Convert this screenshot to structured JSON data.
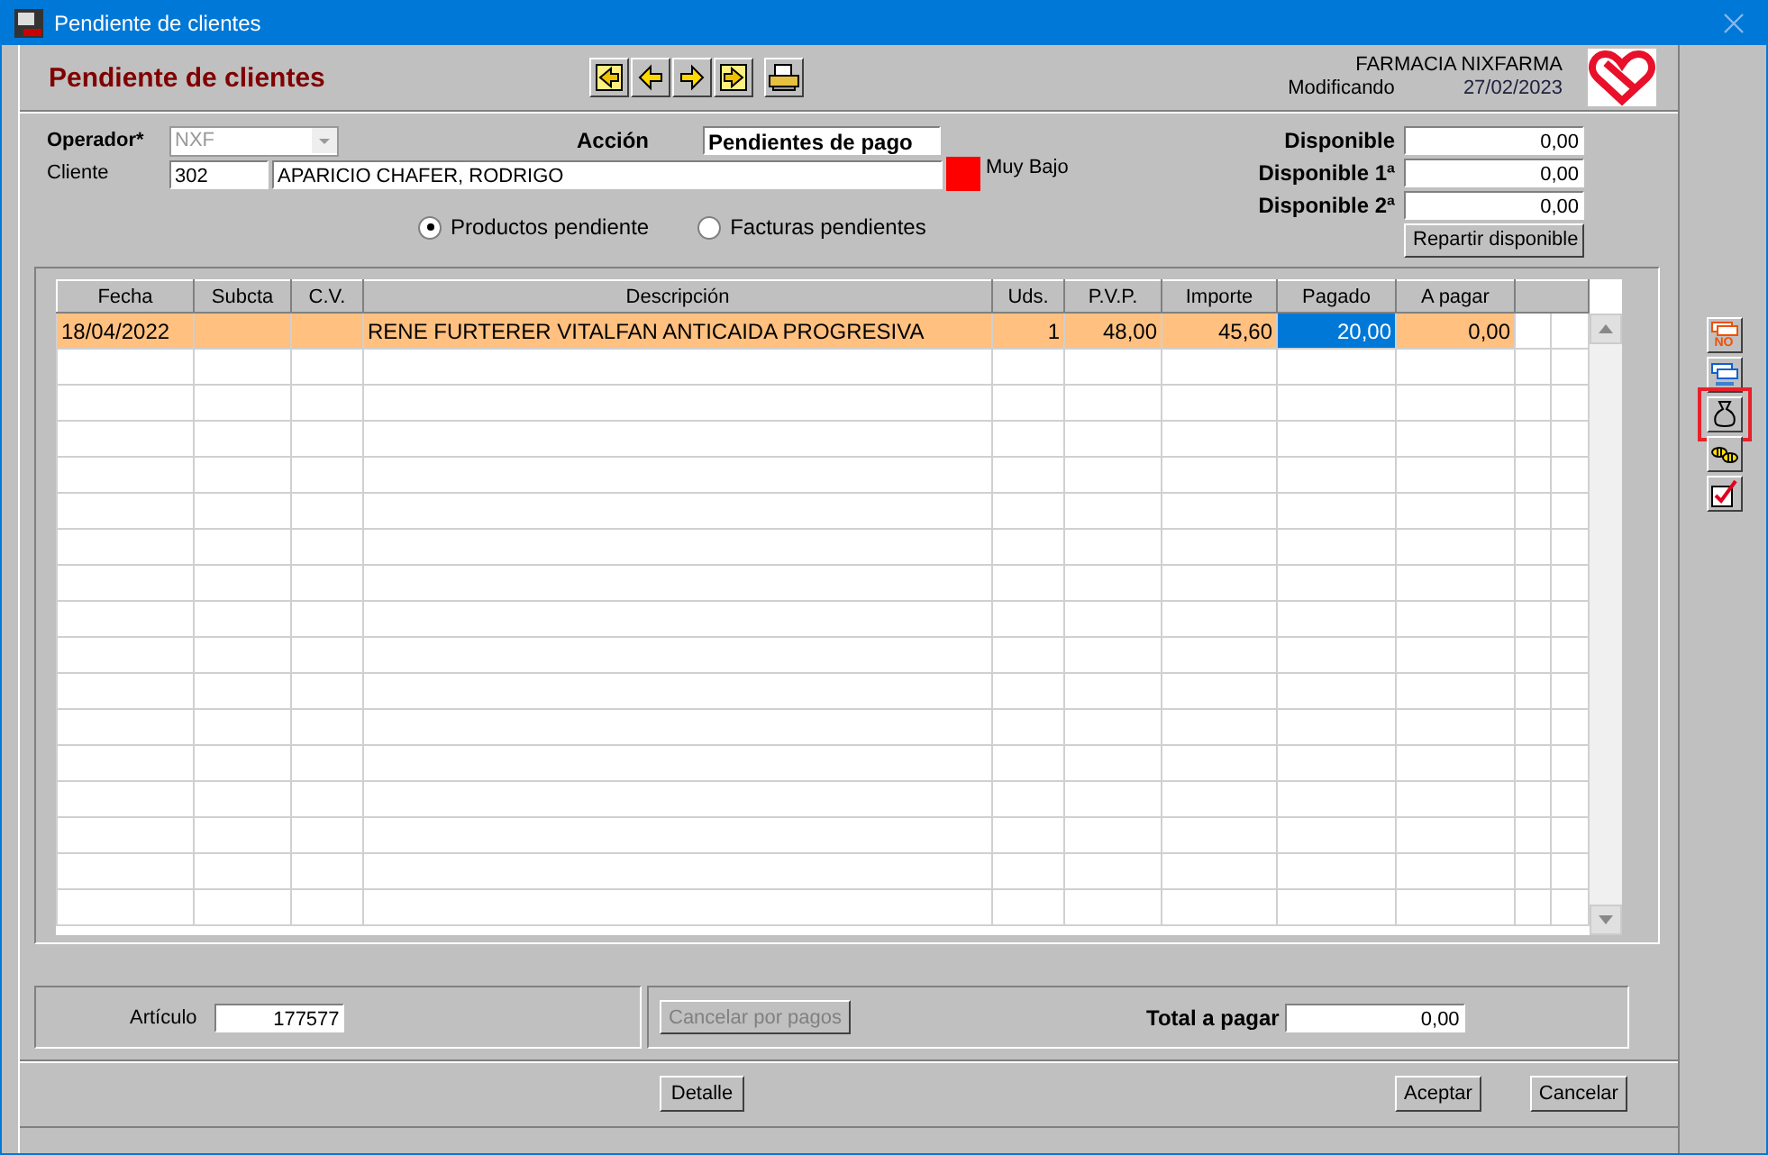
{
  "window": {
    "title": "Pendiente de clientes"
  },
  "header": {
    "title": "Pendiente de clientes",
    "company": "FARMACIA NIXFARMA",
    "mode": "Modificando",
    "date": "27/02/2023"
  },
  "form": {
    "operador_label": "Operador*",
    "operador": "NXF",
    "operador_disabled": true,
    "accion_label": "Acción",
    "accion": "Pendientes de pago",
    "cliente_label": "Cliente",
    "cliente_code": "302",
    "cliente_name": "APARICIO CHAFER, RODRIGO",
    "risk_label": "Muy Bajo"
  },
  "disponible": [
    {
      "label": "Disponible",
      "value": "0,00"
    },
    {
      "label": "Disponible 1ª",
      "value": "0,00"
    },
    {
      "label": "Disponible 2ª",
      "value": "0,00"
    }
  ],
  "repartir_button": "Repartir disponible",
  "view_options": [
    {
      "label": "Productos pendiente",
      "selected": true
    },
    {
      "label": "Facturas pendientes",
      "selected": false
    }
  ],
  "table": {
    "columns": [
      {
        "label": "Fecha"
      },
      {
        "label": "Subcta"
      },
      {
        "label": "C.V."
      },
      {
        "label": "Descripción"
      },
      {
        "label": "Uds."
      },
      {
        "label": "P.V.P."
      },
      {
        "label": "Importe"
      },
      {
        "label": "Pagado"
      },
      {
        "label": "A pagar"
      }
    ],
    "rows": [
      {
        "selected": true,
        "cells": [
          {
            "text": "18/04/2022",
            "focused": false
          },
          {
            "focused": false
          },
          {
            "focused": false
          },
          {
            "text": "RENE FURTERER VITALFAN ANTICAIDA PROGRESIVA",
            "focused": false
          },
          {
            "text": "1",
            "focused": false
          },
          {
            "text": "48,00",
            "focused": false
          },
          {
            "text": "45,60",
            "focused": false
          },
          {
            "text": "20,00",
            "focused": true
          },
          {
            "text": "0,00",
            "focused": false
          }
        ]
      }
    ]
  },
  "bottom": {
    "articulo_label": "Artículo",
    "articulo": "177577",
    "cancel_button": {
      "label": "Cancelar por pagos",
      "disabled": true
    },
    "total_label": "Total a pagar",
    "total": "0,00"
  },
  "footer": {
    "center_buttons": [
      "Detalle"
    ],
    "right_buttons": [
      "Aceptar",
      "Cancelar"
    ]
  },
  "side_tools": [
    {
      "kind": "no",
      "label": "NO",
      "highlighted": false
    },
    {
      "kind": "si",
      "highlighted": false
    },
    {
      "kind": "money-bag",
      "highlighted": true
    },
    {
      "kind": "bees",
      "highlighted": false
    },
    {
      "kind": "check",
      "highlighted": false
    }
  ]
}
